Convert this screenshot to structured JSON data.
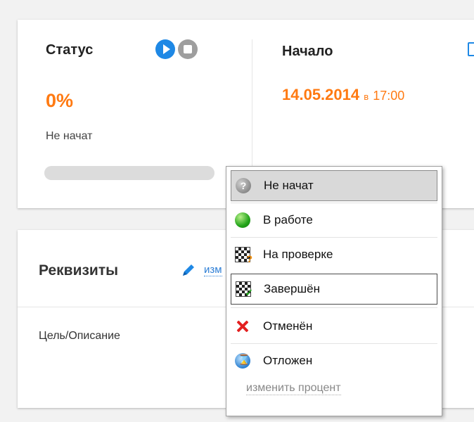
{
  "status_card": {
    "title": "Статус",
    "percent": "0%",
    "progress": 0,
    "status_text": "Не начат"
  },
  "start_card": {
    "title": "Начало",
    "date": "14.05.2014",
    "in": "в",
    "time": "17:00"
  },
  "requisites": {
    "title": "Реквизиты",
    "edit_link": "изм",
    "goal_label": "Цель/Описание"
  },
  "status_menu": {
    "items": [
      {
        "label": "Не начат",
        "icon": "question-icon"
      },
      {
        "label": "В работе",
        "icon": "green-ball-icon"
      },
      {
        "label": "На проверке",
        "icon": "checkered-flag-question-icon"
      },
      {
        "label": "Завершён",
        "icon": "checkered-flag-check-icon"
      },
      {
        "label": "Отменён",
        "icon": "red-x-icon"
      },
      {
        "label": "Отложен",
        "icon": "globe-hourglass-icon"
      }
    ],
    "change_percent_link": "изменить процент"
  },
  "colors": {
    "accent_orange": "#ff7a12",
    "accent_blue": "#1e88e5",
    "link_blue": "#2e7fd6"
  }
}
